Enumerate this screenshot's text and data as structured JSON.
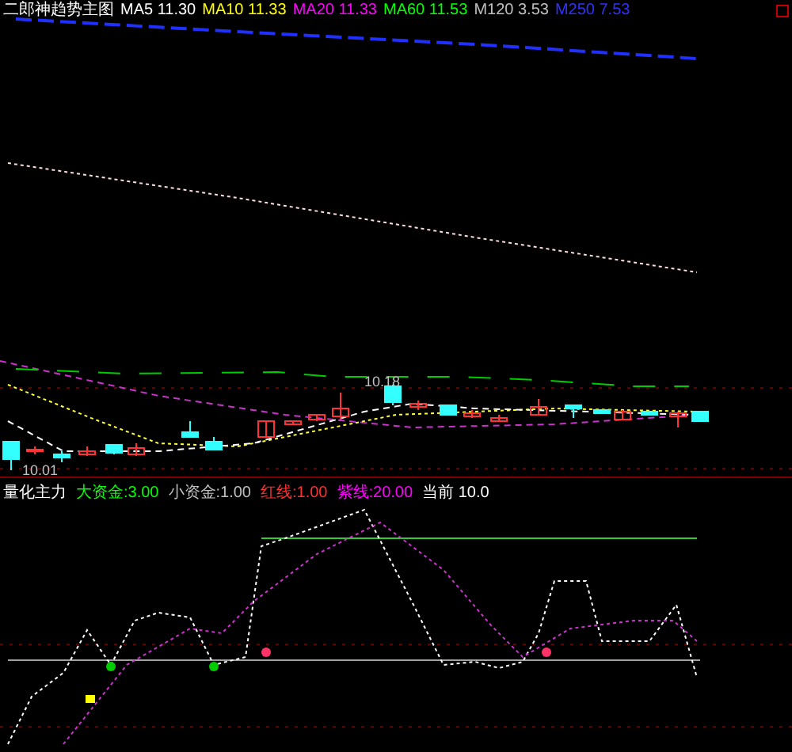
{
  "main_chart": {
    "title": "二郎神趋势主图",
    "legend": [
      {
        "label": "MA5 11.30",
        "color": "#ffffff"
      },
      {
        "label": "MA10 11.33",
        "color": "#ffff00"
      },
      {
        "label": "MA20 11.33",
        "color": "#ff00ff"
      },
      {
        "label": "MA60 11.53",
        "color": "#00ff00"
      },
      {
        "label": "M120 3.53",
        "color": "#c0c0c0"
      },
      {
        "label": "M250 7.53",
        "color": "#3030ff"
      }
    ],
    "price_labels": [
      "10.18",
      "10.01"
    ]
  },
  "indicator": {
    "title": "量化主力",
    "legend": [
      {
        "label": "大资金:3.00",
        "color": "#00ff00"
      },
      {
        "label": "小资金:1.00",
        "color": "#c0c0c0"
      },
      {
        "label": "红线:1.00",
        "color": "#ff3030"
      },
      {
        "label": "紫线:20.00",
        "color": "#ff00ff"
      },
      {
        "label": "当前 10.0",
        "color": "#ffffff"
      }
    ]
  }
}
